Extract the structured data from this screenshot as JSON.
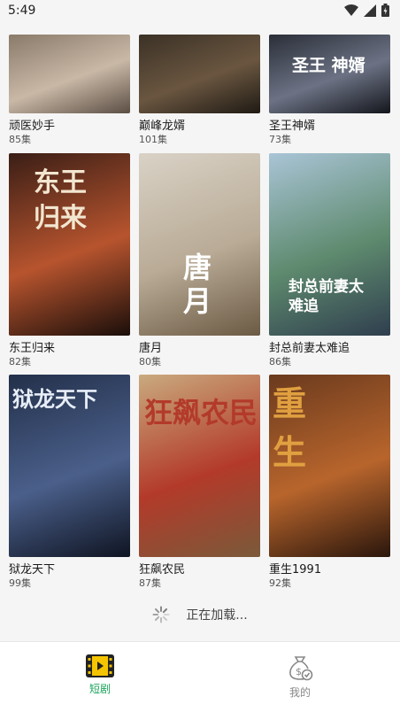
{
  "status": {
    "time": "5:49"
  },
  "dramas": [
    {
      "title": "顽医妙手",
      "episodes": "85集",
      "poster_text": "",
      "colors": [
        "#8a7a6a",
        "#c9b8a6",
        "#5b4e44"
      ]
    },
    {
      "title": "巅峰龙婿",
      "episodes": "101集",
      "poster_text": "",
      "colors": [
        "#3b3126",
        "#6a5640",
        "#1f1a14"
      ]
    },
    {
      "title": "圣王神婿",
      "episodes": "73集",
      "poster_text": "圣王 神婿",
      "colors": [
        "#2a2e38",
        "#6c7284",
        "#14161c"
      ]
    },
    {
      "title": "东王归来",
      "episodes": "82集",
      "poster_text": "东王归来",
      "colors": [
        "#3a1e16",
        "#b7542e",
        "#1a0e0a"
      ]
    },
    {
      "title": "唐月",
      "episodes": "80集",
      "poster_text": "唐月",
      "colors": [
        "#d9d2c6",
        "#b9ab96",
        "#6b5a44"
      ]
    },
    {
      "title": "封总前妻太难追",
      "episodes": "86集",
      "poster_text": "封总前妻太难追",
      "colors": [
        "#a9c4d6",
        "#5e8a6e",
        "#2f3e4e"
      ]
    },
    {
      "title": "狱龙天下",
      "episodes": "99集",
      "poster_text": "狱龙天下",
      "colors": [
        "#23304a",
        "#4a5f8a",
        "#0f1422"
      ]
    },
    {
      "title": "狂飙农民",
      "episodes": "87集",
      "poster_text": "狂飙农民",
      "colors": [
        "#c9aa7e",
        "#b33a2a",
        "#7a5a3a"
      ]
    },
    {
      "title": "重生1991",
      "episodes": "92集",
      "poster_text": "重生",
      "colors": [
        "#6a3a1e",
        "#b8652c",
        "#2a160c"
      ]
    }
  ],
  "loading": {
    "text": "正在加载..."
  },
  "nav": {
    "active_color": "#1aa35b",
    "inactive_color": "#888888",
    "items": [
      {
        "label": "短剧",
        "icon": "film-icon"
      },
      {
        "label": "我的",
        "icon": "money-bag-icon"
      }
    ]
  }
}
